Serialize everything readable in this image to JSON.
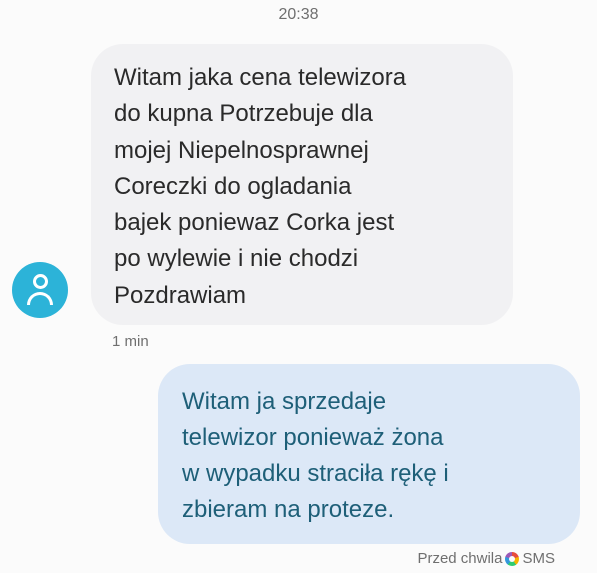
{
  "header": {
    "time": "20:38"
  },
  "incoming": {
    "avatar_icon": "contact-avatar-icon",
    "text": "Witam jaka cena telewizora\ndo kupna Potrzebuje dla\nmojej Niepelnosprawnej\nCoreczki do ogladania\nbajek poniewaz Corka jest\npo wylewie i nie chodzi\nPozdrawiam",
    "time": "1 min"
  },
  "outgoing": {
    "text": "Witam ja sprzedaje\ntelewizor ponieważ żona\nw wypadku straciła rękę i\nzbieram na proteze.",
    "time": "Przed chwila",
    "status_icon": "rcs-status-icon",
    "channel": "SMS"
  },
  "colors": {
    "incoming_bubble": "#f1f1f3",
    "outgoing_bubble": "#dce8f7",
    "outgoing_text": "#1e5f78",
    "avatar": "#2cb3d8"
  }
}
